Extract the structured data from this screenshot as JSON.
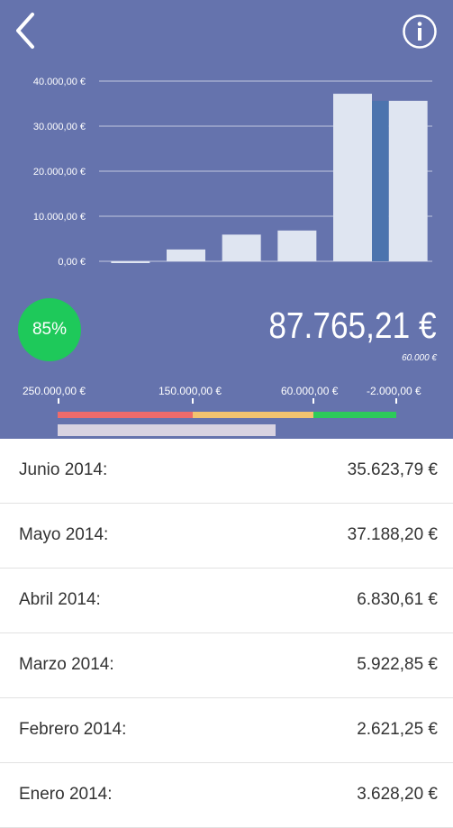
{
  "header": {
    "back_icon": "chevron-left-icon",
    "info_icon": "info-circle-icon",
    "background": "#6573ad"
  },
  "chart_data": {
    "type": "bar",
    "categories": [
      "Enero 2014",
      "Febrero 2014",
      "Marzo 2014",
      "Abril 2014",
      "Mayo 2014",
      "Junio 2014"
    ],
    "values": [
      -400,
      2621.25,
      5922.85,
      6830.61,
      37188.2,
      35623.79
    ],
    "ylim": [
      0,
      40000
    ],
    "yticks": [
      "0,00 €",
      "10.000,00 €",
      "20.000,00 €",
      "30.000,00 €",
      "40.000,00 €"
    ],
    "ytick_values": [
      0,
      10000,
      20000,
      30000,
      40000
    ],
    "grid": true,
    "bar_color": "#dfe5f1",
    "highlight_color": "#4c74ae"
  },
  "summary": {
    "percent": "85%",
    "percent_color": "#1ec95a",
    "total": "87.765,21 €",
    "target": "60.000 €"
  },
  "scale": {
    "labels": [
      "250.000,00 €",
      "150.000,00 €",
      "60.000,00 €",
      "-2.000,00 €"
    ],
    "colors": [
      "#ee6b6b",
      "#f2c36f",
      "#2ccb5a"
    ],
    "progress_color": "#d8d3e1"
  },
  "months": [
    {
      "label": "Junio 2014:",
      "value": "35.623,79 €"
    },
    {
      "label": "Mayo 2014:",
      "value": "37.188,20 €"
    },
    {
      "label": "Abril 2014:",
      "value": "6.830,61 €"
    },
    {
      "label": "Marzo 2014:",
      "value": "5.922,85 €"
    },
    {
      "label": "Febrero 2014:",
      "value": "2.621,25 €"
    },
    {
      "label": "Enero  2014:",
      "value": "3.628,20 €"
    }
  ]
}
